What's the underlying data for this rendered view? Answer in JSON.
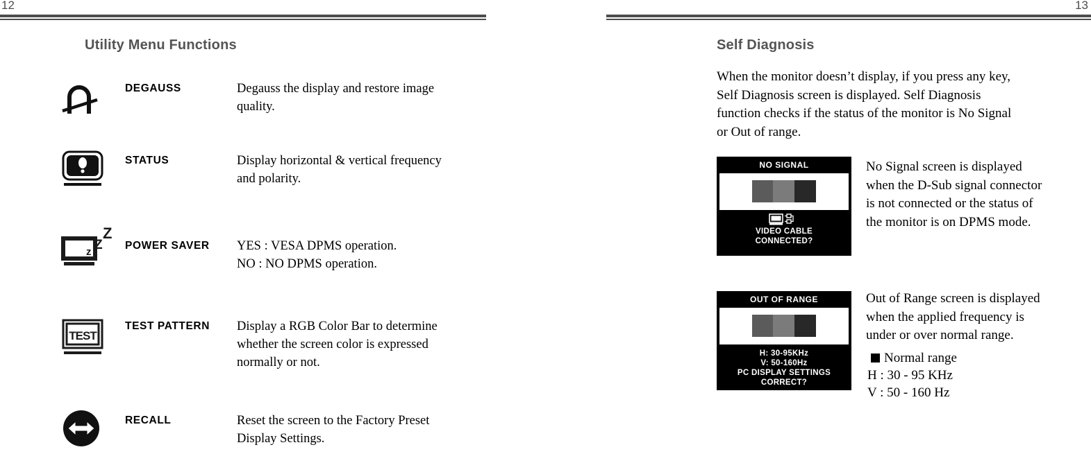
{
  "document": {
    "left_page": {
      "folio": "12",
      "title": "Utility Menu Functions",
      "functions": [
        {
          "icon": "degauss-icon",
          "name": "DEGAUSS",
          "desc_lines": [
            "Degauss the display and restore image",
            "quality."
          ]
        },
        {
          "icon": "status-monitor-icon",
          "name": "STATUS",
          "desc_lines": [
            "Display horizontal & vertical frequency",
            "and polarity."
          ]
        },
        {
          "icon": "power-saver-icon",
          "name": "POWER SAVER",
          "desc_lines": [
            "YES : VESA DPMS operation.",
            "NO : NO DPMS operation."
          ]
        },
        {
          "icon": "test-pattern-icon",
          "name": "TEST PATTERN",
          "desc_lines": [
            "Display a RGB Color Bar to determine",
            "whether the screen color is expressed",
            "normally or not."
          ]
        },
        {
          "icon": "recall-icon",
          "name": "RECALL",
          "desc_lines": [
            "Reset the screen to the Factory Preset",
            "Display Settings."
          ]
        }
      ]
    },
    "right_page": {
      "folio": "13",
      "title": "Self Diagnosis",
      "intro_lines": [
        "When the monitor doesn’t  display, if you press any key,",
        "Self Diagnosis screen is displayed.  Self Diagnosis",
        "function checks if the status of the monitor is No Signal",
        "or Out of range."
      ],
      "cases": [
        {
          "osd": {
            "title": "NO SIGNAL",
            "footer_lines": [
              "VIDEO CABLE",
              "CONNECTED?"
            ],
            "footer_icon": "video-cable-icon",
            "bars": [
              "#5b5b5b",
              "#7b7b7b",
              "#282828"
            ]
          },
          "desc_lines": [
            "No Signal screen is displayed",
            "when the D-Sub signal connector",
            "is not connected or the status of",
            "the monitor is on DPMS mode."
          ]
        },
        {
          "osd": {
            "title": "OUT OF RANGE",
            "footer_lines": [
              "H: 30-95KHz",
              "V: 50-160Hz",
              "PC DISPLAY SETTINGS",
              "CORRECT?"
            ],
            "footer_icon": "",
            "bars": [
              "#5b5b5b",
              "#7b7b7b",
              "#282828"
            ]
          },
          "desc_lines": [
            "Out of Range screen is displayed",
            "when the applied frequency is",
            "under or over normal range."
          ],
          "range": {
            "legend": "Normal range",
            "lines": [
              "H : 30 - 95 KHz",
              "V : 50 - 160 Hz"
            ]
          }
        }
      ]
    }
  },
  "colors": {
    "rule": "#4d4d4d",
    "heading": "#545454",
    "osd_background": "#000000",
    "osd_text": "#ffffff"
  }
}
